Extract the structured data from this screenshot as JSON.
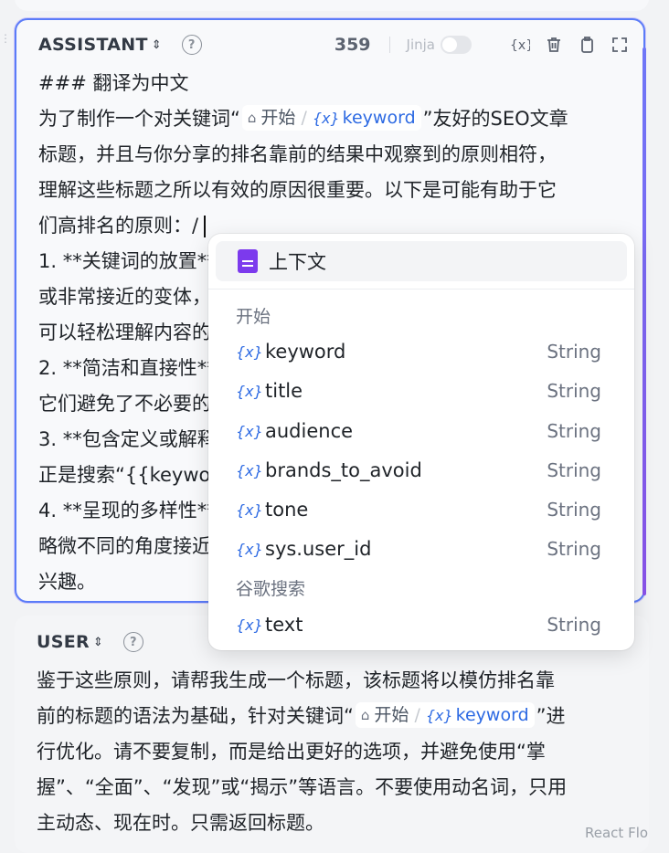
{
  "assistant": {
    "role": "ASSISTANT",
    "token_count": "359",
    "jinja_label": "Jinja",
    "lines": [
      "### 翻译为中文",
      "",
      "标题，并且与你分享的排名靠前的结果中观察到的原则相符，",
      "理解这些标题之所以有效的原因很重要。以下是可能有助于它",
      "们高排名的原则：/",
      "1. **关键词的放置**：",
      "或非常接近的变体，",
      "可以轻松理解内容的",
      "2. **简洁和直接性**：",
      "它们避免了不必要的",
      "3. **包含定义或解释**：",
      "正是搜索“{{keyword}}",
      "4. **呈现的多样性**：",
      "略微不同的角度接近",
      "兴趣。"
    ],
    "line2_prefix": "为了制作一个对关键词“",
    "line2_suffix": "”友好的SEO文章"
  },
  "chip": {
    "node": "开始",
    "separator": "/",
    "variable": "keyword"
  },
  "dropdown": {
    "context_label": "上下文",
    "groups": [
      {
        "label": "开始",
        "items": [
          {
            "name": "keyword",
            "type": "String"
          },
          {
            "name": "title",
            "type": "String"
          },
          {
            "name": "audience",
            "type": "String"
          },
          {
            "name": "brands_to_avoid",
            "type": "String"
          },
          {
            "name": "tone",
            "type": "String"
          },
          {
            "name": "sys.user_id",
            "type": "String"
          }
        ]
      },
      {
        "label": "谷歌搜索",
        "items": [
          {
            "name": "text",
            "type": "String"
          }
        ]
      }
    ]
  },
  "user": {
    "role": "USER",
    "line1": "鉴于这些原则，请帮我生成一个标题，该标题将以模仿排名靠",
    "line2_prefix": "前的标题的语法为基础，针对关键词“",
    "line2_suffix": "”进",
    "line3": "行优化。请不要复制，而是给出更好的选项，并避免使用“掌",
    "line4": "握”、“全面”、“发现”或“揭示”等语言。不要使用动名词，只用",
    "line5": "主动态、现在时。只需返回标题。"
  },
  "footer_partial": "React Flo"
}
